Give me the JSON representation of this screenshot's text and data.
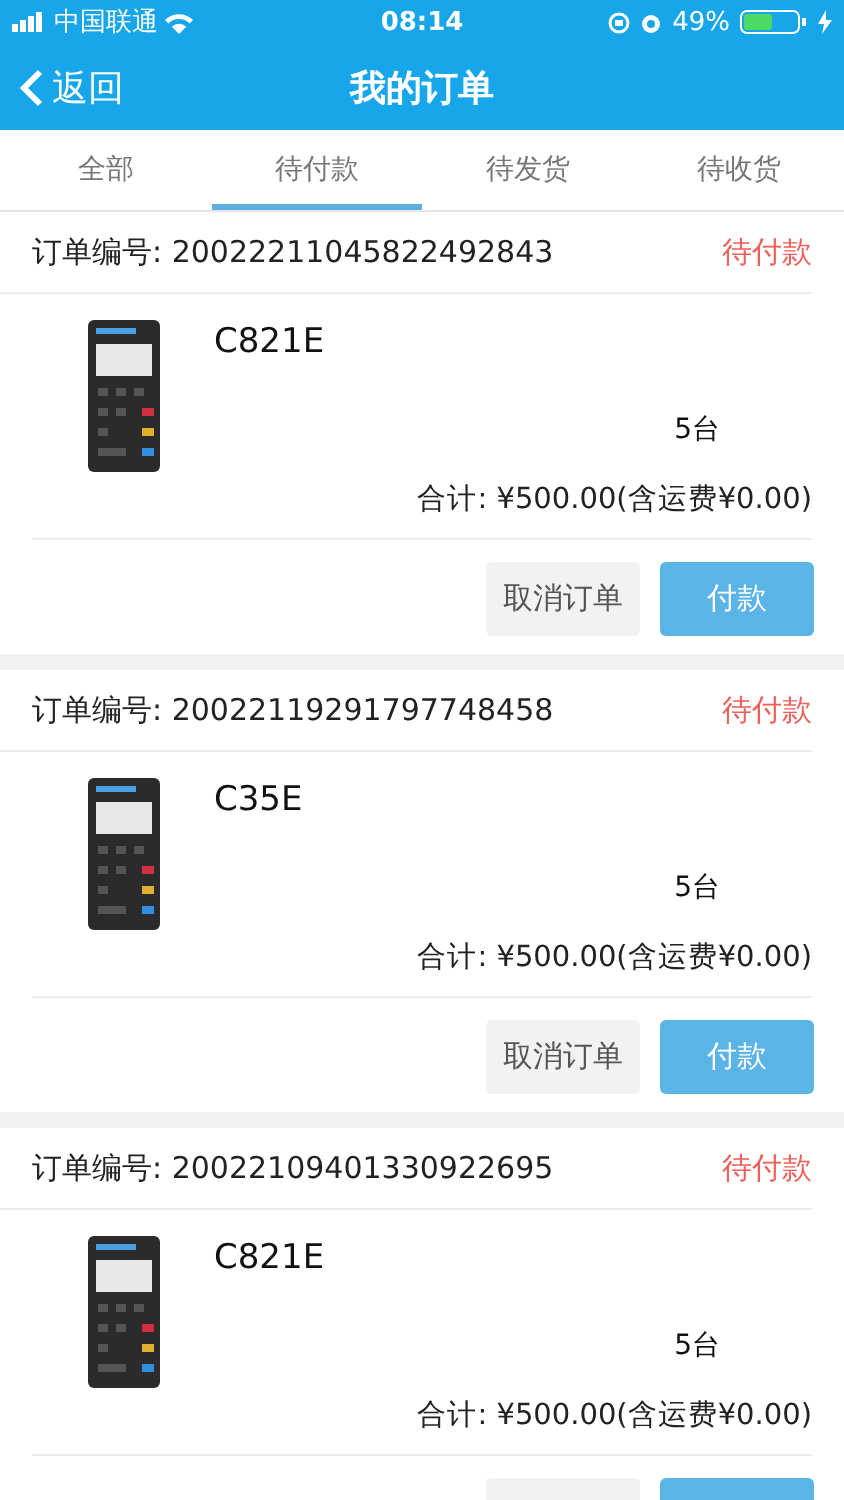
{
  "status_bar": {
    "carrier": "中国联通",
    "time": "08:14",
    "battery": "49%"
  },
  "nav": {
    "back": "返回",
    "title": "我的订单"
  },
  "tabs": [
    {
      "label": "全部",
      "selected": false
    },
    {
      "label": "待付款",
      "selected": true
    },
    {
      "label": "待发货",
      "selected": false
    },
    {
      "label": "待收货",
      "selected": false
    }
  ],
  "orders": [
    {
      "number_label": "订单编号: 20022211045822492843",
      "status": "待付款",
      "product": {
        "name": "C821E",
        "kind": "picture"
      },
      "quantity": "5台",
      "total": "合计: ¥500.00(含运费¥0.00)",
      "actions": [
        {
          "kind": "cancel",
          "label": "取消订单"
        },
        {
          "kind": "pay",
          "label": "付款"
        }
      ]
    },
    {
      "number_label": "订单编号: 20022119291797748458",
      "status": "待付款",
      "product": {
        "name": "C35E",
        "kind": "picture"
      },
      "quantity": "5台",
      "total": "合计: ¥500.00(含运费¥0.00)",
      "actions": [
        {
          "kind": "cancel",
          "label": "取消订单"
        },
        {
          "kind": "pay",
          "label": "付款"
        }
      ]
    },
    {
      "number_label": "订单编号: 20022109401330922695",
      "status": "待付款",
      "product": {
        "name": "C821E",
        "kind": "picture"
      },
      "quantity": "5台",
      "total": "合计: ¥500.00(含运费¥0.00)",
      "actions": [
        {
          "kind": "cancel"
        },
        {
          "kind": "pay"
        }
      ]
    }
  ]
}
